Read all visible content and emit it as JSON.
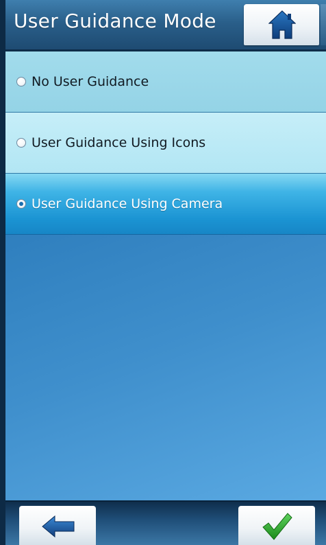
{
  "header": {
    "title": "User Guidance Mode",
    "home_icon": "home-icon"
  },
  "options": [
    {
      "label": "No User Guidance",
      "selected": false
    },
    {
      "label": "User Guidance Using Icons",
      "selected": false
    },
    {
      "label": "User Guidance Using Camera",
      "selected": true
    }
  ],
  "footer": {
    "back_icon": "back-arrow-icon",
    "confirm_icon": "checkmark-icon"
  },
  "colors": {
    "header": "#2a5f8a",
    "selected_row": "#1b94d3",
    "row_1": "#a2dcec",
    "row_2": "#c6eef8",
    "content": "#3f8fcc",
    "check": "#2bb02b",
    "arrow": "#1b5fa8"
  }
}
